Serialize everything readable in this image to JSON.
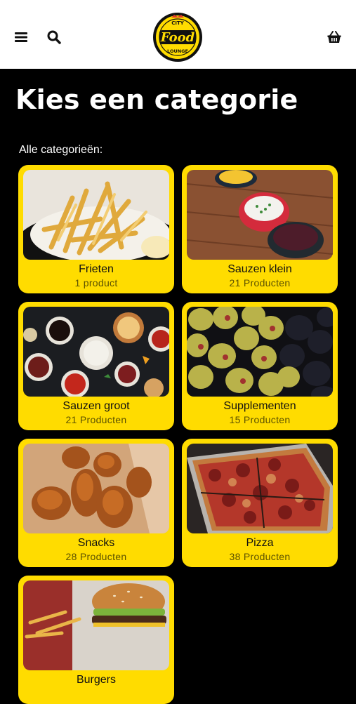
{
  "header": {
    "menu_icon": "menu-icon",
    "search_icon": "search-icon",
    "cart_icon": "basket-icon",
    "logo": {
      "top_text": "CITY",
      "main_text": "Food",
      "bottom_text": "LOUNGE"
    }
  },
  "page": {
    "title": "Kies een categorie",
    "subtitle": "Alle categorieën:"
  },
  "categories": [
    {
      "name": "Frieten",
      "count": "1 product"
    },
    {
      "name": "Sauzen klein",
      "count": "21 Producten"
    },
    {
      "name": "Sauzen groot",
      "count": "21 Producten"
    },
    {
      "name": "Supplementen",
      "count": "15 Producten"
    },
    {
      "name": "Snacks",
      "count": "28 Producten"
    },
    {
      "name": "Pizza",
      "count": "38 Producten"
    },
    {
      "name": "Burgers",
      "count": ""
    }
  ],
  "colors": {
    "accent": "#ffdc00",
    "background": "#000000",
    "header": "#ffffff"
  }
}
